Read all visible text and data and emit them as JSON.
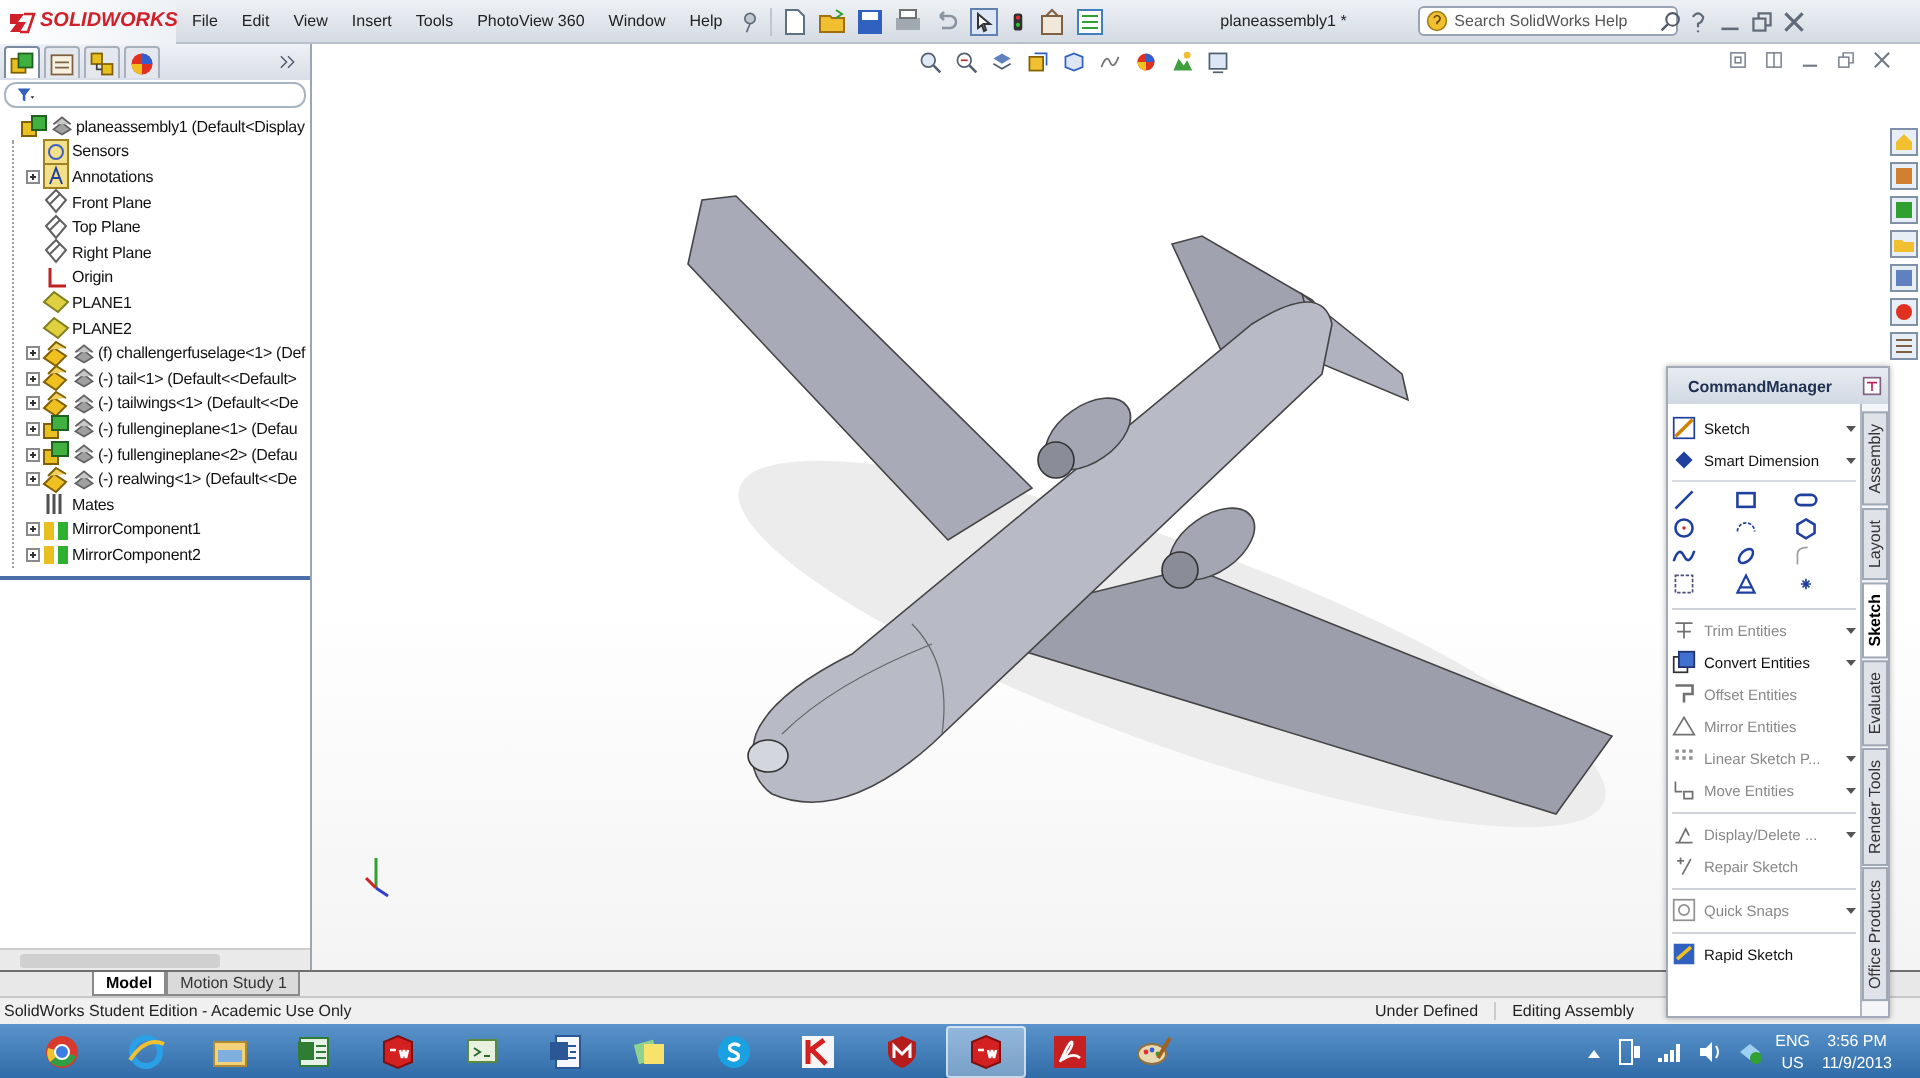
{
  "app": {
    "brand": "SOLIDWORKS",
    "menus": [
      "File",
      "Edit",
      "View",
      "Insert",
      "Tools",
      "PhotoView 360",
      "Window",
      "Help"
    ],
    "document_title": "planeassembly1 *",
    "search": {
      "placeholder": "Search SolidWorks Help"
    }
  },
  "panel_tabs": [
    {
      "kind": "feature",
      "selected": true
    },
    {
      "kind": "property",
      "selected": false
    },
    {
      "kind": "config",
      "selected": false
    },
    {
      "kind": "display",
      "selected": false
    }
  ],
  "tree": {
    "label": "planeassembly1  (Default<Display",
    "kind": "assembly",
    "collapsed": false,
    "children": [
      {
        "label": "Sensors",
        "kind": "sensor",
        "collapsed": false
      },
      {
        "label": "Annotations",
        "kind": "annotation",
        "collapsed": true
      },
      {
        "label": "Front Plane",
        "kind": "plane",
        "collapsed": false
      },
      {
        "label": "Top Plane",
        "kind": "plane",
        "collapsed": false
      },
      {
        "label": "Right Plane",
        "kind": "plane",
        "collapsed": false
      },
      {
        "label": "Origin",
        "kind": "origin",
        "collapsed": false
      },
      {
        "label": "PLANE1",
        "kind": "refplane",
        "collapsed": false
      },
      {
        "label": "PLANE2",
        "kind": "refplane",
        "collapsed": false
      },
      {
        "label": "(f) challengerfuselage<1> (Def",
        "kind": "part",
        "collapsed": true
      },
      {
        "label": "(-) tail<1> (Default<<Default>",
        "kind": "part",
        "collapsed": true
      },
      {
        "label": "(-) tailwings<1> (Default<<De",
        "kind": "part",
        "collapsed": true
      },
      {
        "label": "(-) fullengineplane<1> (Defau",
        "kind": "subassembly",
        "collapsed": true
      },
      {
        "label": "(-) fullengineplane<2> (Defau",
        "kind": "subassembly",
        "collapsed": true
      },
      {
        "label": "(-) realwing<1> (Default<<De",
        "kind": "part",
        "collapsed": true
      },
      {
        "label": "Mates",
        "kind": "mates",
        "collapsed": false
      },
      {
        "label": "MirrorComponent1",
        "kind": "mirror",
        "collapsed": true
      },
      {
        "label": "MirrorComponent2",
        "kind": "mirror",
        "collapsed": true
      }
    ]
  },
  "bottom_tabs": [
    {
      "label": "Model",
      "selected": true
    },
    {
      "label": "Motion Study 1",
      "selected": false
    }
  ],
  "command_manager": {
    "title": "CommandManager",
    "top_tools": [
      {
        "label": "Sketch",
        "disabled": false,
        "dropdown": true
      },
      {
        "label": "Smart Dimension",
        "disabled": false,
        "dropdown": true
      }
    ],
    "tools": [
      {
        "label": "Trim Entities",
        "disabled": true,
        "dropdown": true,
        "divider_before": true
      },
      {
        "label": "Convert Entities",
        "disabled": false,
        "dropdown": true,
        "divider_before": false
      },
      {
        "label": "Offset Entities",
        "disabled": true,
        "dropdown": false,
        "divider_before": false
      },
      {
        "label": "Mirror Entities",
        "disabled": true,
        "dropdown": false,
        "divider_before": false
      },
      {
        "label": "Linear Sketch P...",
        "disabled": true,
        "dropdown": true,
        "divider_before": false
      },
      {
        "label": "Move Entities",
        "disabled": true,
        "dropdown": true,
        "divider_before": false
      },
      {
        "label": "Display/Delete ...",
        "disabled": true,
        "dropdown": true,
        "divider_before": true
      },
      {
        "label": "Repair Sketch",
        "disabled": true,
        "dropdown": false,
        "divider_before": false
      },
      {
        "label": "Quick Snaps",
        "disabled": true,
        "dropdown": true,
        "divider_before": true
      },
      {
        "label": "Rapid Sketch",
        "disabled": false,
        "dropdown": false,
        "divider_before": true
      }
    ],
    "tabs": [
      {
        "label": "Assembly",
        "selected": false
      },
      {
        "label": "Layout",
        "selected": false
      },
      {
        "label": "Sketch",
        "selected": true
      },
      {
        "label": "Evaluate",
        "selected": false
      },
      {
        "label": "Render Tools",
        "selected": false
      },
      {
        "label": "Office Products",
        "selected": false
      }
    ]
  },
  "status_bar": {
    "edition": "SolidWorks Student Edition - Academic Use Only",
    "state": "Under Defined",
    "mode": "Editing Assembly"
  },
  "taskbar": {
    "apps": [
      {
        "kind": "browser-round",
        "selected": false
      },
      {
        "kind": "browser-e",
        "selected": false
      },
      {
        "kind": "folder",
        "selected": false
      },
      {
        "kind": "spreadsheet",
        "selected": false
      },
      {
        "kind": "cad",
        "selected": false
      },
      {
        "kind": "code",
        "selected": false
      },
      {
        "kind": "document",
        "selected": false
      },
      {
        "kind": "notes",
        "selected": false
      },
      {
        "kind": "chat",
        "selected": false
      },
      {
        "kind": "antivirus",
        "selected": false
      },
      {
        "kind": "shield",
        "selected": false
      },
      {
        "kind": "cad",
        "selected": true
      },
      {
        "kind": "pdf",
        "selected": false
      },
      {
        "kind": "paint",
        "selected": false
      }
    ],
    "language": "ENG",
    "region": "US",
    "time": "3:56 PM",
    "date": "11/9/2013"
  }
}
